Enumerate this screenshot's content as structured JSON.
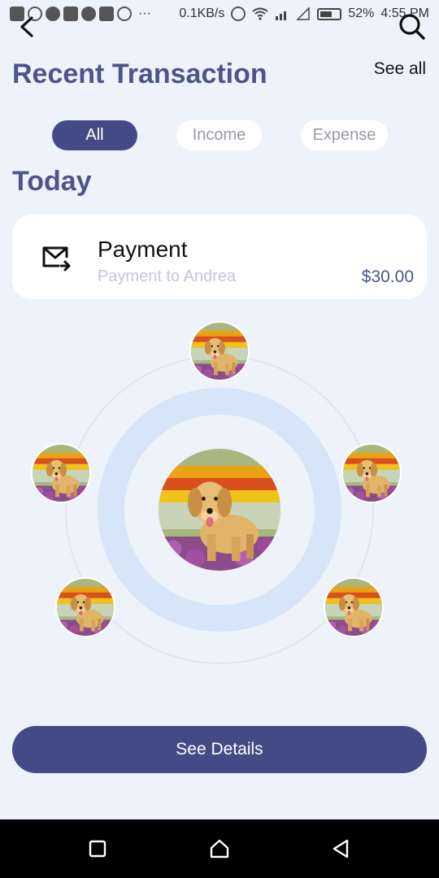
{
  "status_bar": {
    "speed": "0.1KB/s",
    "battery": "52%",
    "time": "4:55 PM",
    "more": "···"
  },
  "header": {
    "title": "Recent Transaction",
    "see_all": "See all"
  },
  "filters": [
    {
      "label": "All",
      "active": true
    },
    {
      "label": "Income",
      "active": false
    },
    {
      "label": "Expense",
      "active": false
    }
  ],
  "section": {
    "title": "Today"
  },
  "transaction": {
    "title": "Payment",
    "subtitle": "Payment to Andrea",
    "amount": "$30.00",
    "icon": "mail-send-icon"
  },
  "cta": {
    "label": "See Details"
  },
  "colors": {
    "accent": "#434b86",
    "title": "#4c5589",
    "background": "#eef3fb",
    "ring": "#d6e5f8"
  }
}
